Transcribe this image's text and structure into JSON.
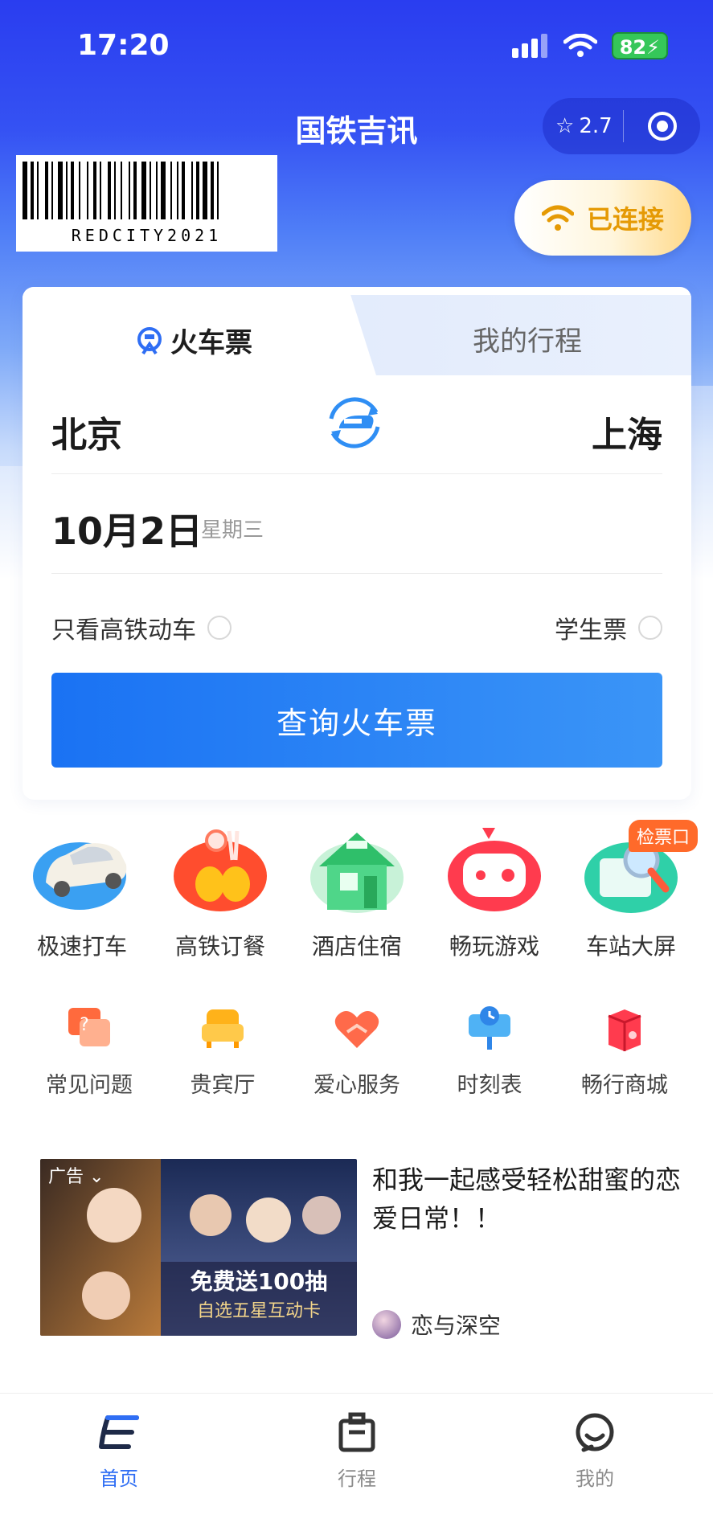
{
  "status_bar": {
    "time": "17:20",
    "battery": "82"
  },
  "header": {
    "title": "国铁吉讯",
    "rating": "2.7"
  },
  "barcode_text": "REDCITY2021",
  "wifi_button": {
    "label": "已连接"
  },
  "ticket_card": {
    "tabs": [
      "火车票",
      "我的行程"
    ],
    "from_city": "北京",
    "to_city": "上海",
    "date": "10月2日",
    "weekday": "星期三",
    "option_high_speed": "只看高铁动车",
    "option_student": "学生票",
    "search_button": "查询火车票"
  },
  "services_main": [
    {
      "label": "极速打车",
      "icon": "car-icon"
    },
    {
      "label": "高铁订餐",
      "icon": "meal-icon"
    },
    {
      "label": "酒店住宿",
      "icon": "hotel-icon"
    },
    {
      "label": "畅玩游戏",
      "icon": "game-icon"
    },
    {
      "label": "车站大屏",
      "icon": "station-screen-icon"
    }
  ],
  "services_badge": "检票口",
  "services_secondary": [
    {
      "label": "常见问题",
      "icon": "faq-icon"
    },
    {
      "label": "贵宾厅",
      "icon": "vip-lounge-icon"
    },
    {
      "label": "爱心服务",
      "icon": "heart-service-icon"
    },
    {
      "label": "时刻表",
      "icon": "timetable-icon"
    },
    {
      "label": "畅行商城",
      "icon": "mall-icon"
    }
  ],
  "ad": {
    "tag": "广告",
    "title": "和我一起感受轻松甜蜜的恋爱日常！！",
    "source": "恋与深空",
    "image_text": [
      "免费送100抽",
      "自选五星互动卡"
    ]
  },
  "tab_bar": [
    {
      "label": "首页",
      "active": true
    },
    {
      "label": "行程",
      "active": false
    },
    {
      "label": "我的",
      "active": false
    }
  ],
  "colors": {
    "primary": "#2f6ef4",
    "accent": "#e59a05",
    "badge": "#ff6a2a"
  }
}
